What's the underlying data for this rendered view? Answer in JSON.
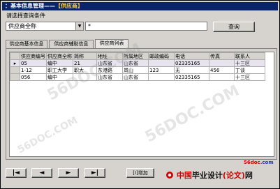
{
  "window": {
    "title_main": "：基本信息管理——",
    "title_accent": "【供应商】"
  },
  "search": {
    "prompt": "请选择查询条件",
    "field_selected": "供应商全称",
    "query_text": "*",
    "query_button": "查询"
  },
  "tabs": [
    {
      "label": "供应商基本信息",
      "active": false
    },
    {
      "label": "供应商辅助信息",
      "active": false
    },
    {
      "label": "供应商列表",
      "active": true
    }
  ],
  "grid": {
    "columns": [
      "供应商编号",
      "供应商全称",
      "简称",
      "地址",
      "所属地区",
      "邮政编码",
      "电话",
      "传真",
      "联系人"
    ],
    "rows": [
      [
        "05",
        "编中",
        "21",
        "山东省",
        "山东省",
        "",
        "02335165",
        "",
        "十三区"
      ],
      [
        "1-12",
        "职工大学",
        "职大",
        "东港路",
        "岚山",
        "123",
        "无",
        "456",
        "丁谈"
      ],
      [
        "056",
        "编中",
        "",
        "山东省",
        "山东省",
        "",
        "02335165",
        "",
        "十三区"
      ]
    ]
  },
  "navigation": {
    "first": "|◄",
    "prev": "◄",
    "next": "►",
    "last": "►|",
    "add_label": "[I]增加"
  },
  "branding": {
    "logo_cn": "中国",
    "logo_text_a": "毕业设计",
    "logo_text_b": "(论文)",
    "logo_text_c": "网",
    "site": "56doc",
    "site_tld": ".com",
    "watermark": "56DOC.COM"
  }
}
